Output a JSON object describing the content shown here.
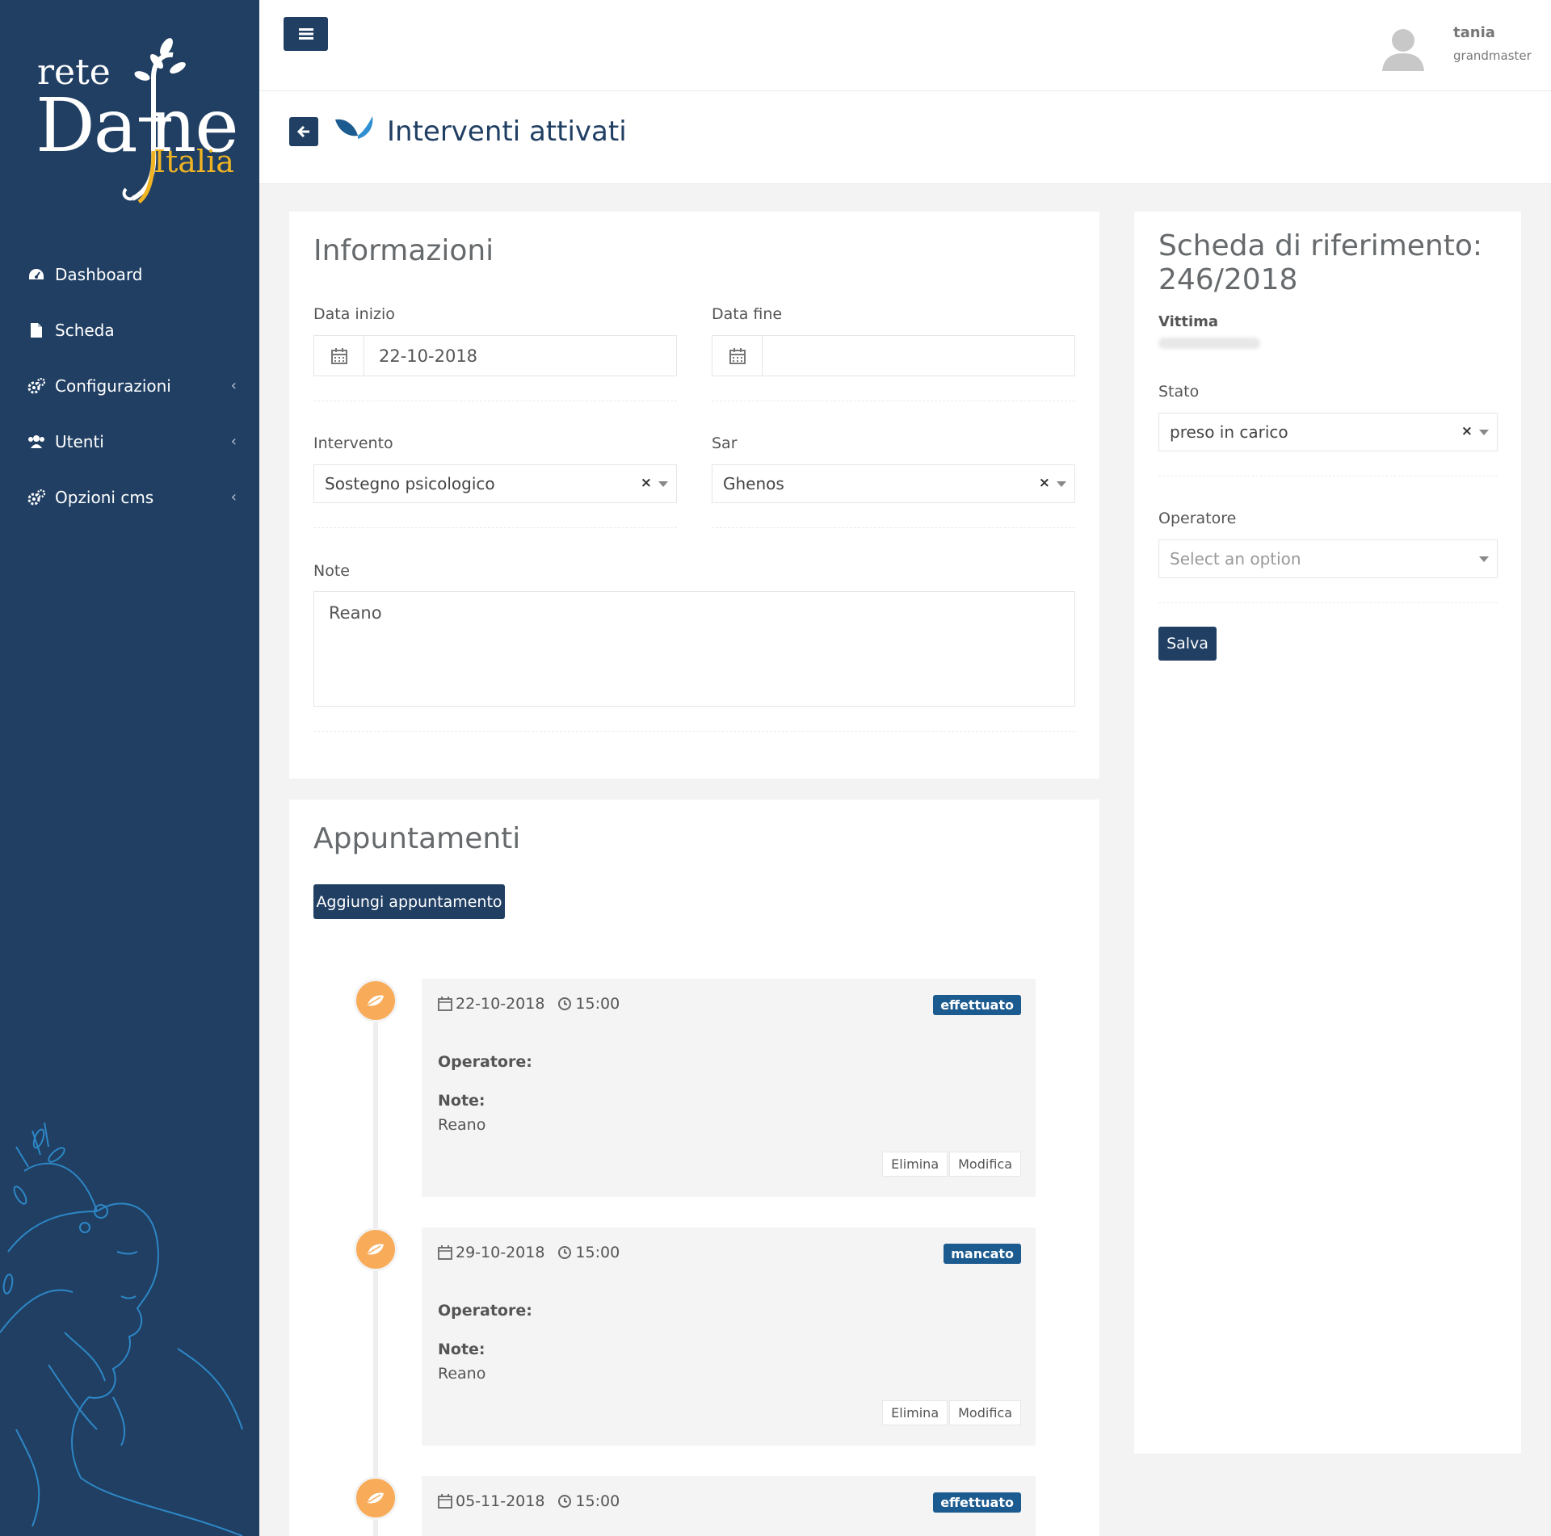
{
  "sidebar": {
    "logo": {
      "word1": "rete",
      "word2a": "Da",
      "word2b": "ne",
      "word3": "Italia"
    },
    "items": [
      {
        "label": "Dashboard",
        "icon": "dashboard-icon"
      },
      {
        "label": "Scheda",
        "icon": "file-icon"
      },
      {
        "label": "Configurazioni",
        "icon": "gears-icon"
      },
      {
        "label": "Utenti",
        "icon": "users-icon"
      },
      {
        "label": "Opzioni cms",
        "icon": "gears-icon"
      }
    ],
    "chevron": "‹"
  },
  "topbar": {
    "user_name": "tania",
    "user_role": "grandmaster"
  },
  "heading": {
    "title": "Interventi attivati"
  },
  "info": {
    "title": "Informazioni",
    "data_inizio_label": "Data inizio",
    "data_inizio_value": "22-10-2018",
    "data_fine_label": "Data fine",
    "data_fine_value": "",
    "intervento_label": "Intervento",
    "intervento_value": "Sostegno psicologico",
    "sar_label": "Sar",
    "sar_value": "Ghenos",
    "note_label": "Note",
    "note_value": "Reano",
    "clear": "×"
  },
  "appuntamenti": {
    "title": "Appuntamenti",
    "add_button": "Aggiungi appuntamento",
    "operatore_label": "Operatore:",
    "note_label": "Note:",
    "delete_label": "Elimina",
    "edit_label": "Modifica",
    "items": [
      {
        "date": "22-10-2018",
        "time": "15:00",
        "status": "effettuato",
        "note": "Reano"
      },
      {
        "date": "29-10-2018",
        "time": "15:00",
        "status": "mancato",
        "note": "Reano"
      },
      {
        "date": "05-11-2018",
        "time": "15:00",
        "status": "effettuato",
        "note": ""
      }
    ]
  },
  "scheda": {
    "title_line1": "Scheda di riferimento:",
    "title_line2": "246/2018",
    "vittima_label": "Vittima",
    "stato_label": "Stato",
    "stato_value": "preso in carico",
    "operatore_label": "Operatore",
    "operatore_placeholder": "Select an option",
    "save_button": "Salva",
    "clear": "×"
  },
  "colors": {
    "sidebar": "#203f63",
    "primary": "#203f63",
    "badge": "#1c5b8f",
    "timeline_dot": "#f8ac59",
    "logo_accent": "#f0b323"
  }
}
